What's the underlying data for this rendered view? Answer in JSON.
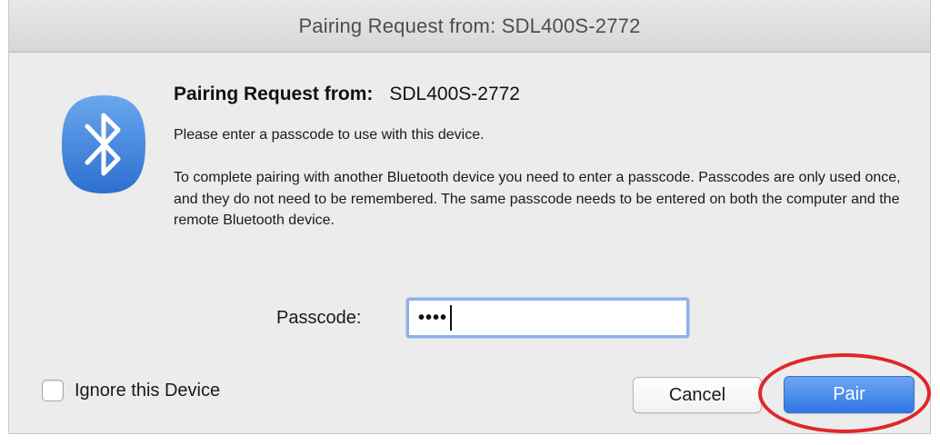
{
  "window": {
    "title": "Pairing Request from: SDL400S-2772"
  },
  "icon": {
    "name": "bluetooth-icon",
    "color": "#3f7fd6"
  },
  "dialog": {
    "heading_label": "Pairing Request from:",
    "heading_device": "SDL400S-2772",
    "subtext": "Please enter a passcode to use with this device.",
    "paragraph": "To complete pairing with another Bluetooth device you need to enter a passcode. Passcodes are only used once, and they do not need to be remembered. The same passcode needs to be entered on both the computer and the remote Bluetooth device.",
    "passcode_label": "Passcode:",
    "passcode_value": "••••",
    "ignore_label": "Ignore this Device",
    "ignore_checked": false,
    "cancel_label": "Cancel",
    "pair_label": "Pair"
  },
  "colors": {
    "accent": "#2f77e5",
    "annotation": "#e0262a",
    "focus_ring": "#8eb3e6"
  }
}
